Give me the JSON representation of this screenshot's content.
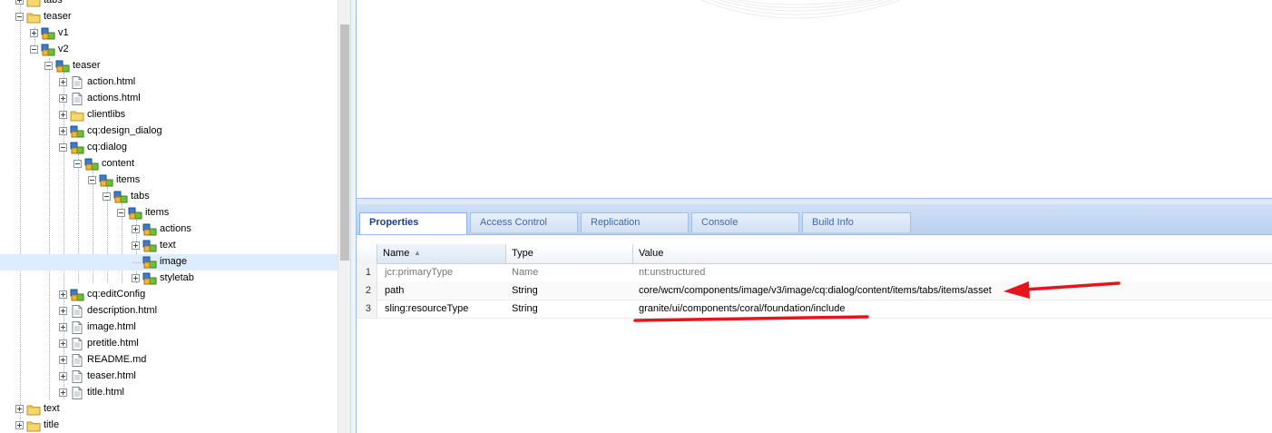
{
  "tree": {
    "nodes": [
      {
        "label": "tabs",
        "icon": "folder-icon",
        "expander": "plus"
      },
      {
        "label": "teaser",
        "icon": "folder-icon",
        "expander": "minus"
      },
      {
        "label": "v1",
        "icon": "component-node-icon",
        "expander": "plus"
      },
      {
        "label": "v2",
        "icon": "component-node-icon",
        "expander": "minus"
      },
      {
        "label": "teaser",
        "icon": "component-node-icon",
        "expander": "minus"
      },
      {
        "label": "action.html",
        "icon": "file-icon",
        "expander": "plus"
      },
      {
        "label": "actions.html",
        "icon": "file-icon",
        "expander": "plus"
      },
      {
        "label": "clientlibs",
        "icon": "folder-icon",
        "expander": "plus"
      },
      {
        "label": "cq:design_dialog",
        "icon": "component-node-icon",
        "expander": "plus"
      },
      {
        "label": "cq:dialog",
        "icon": "component-node-icon",
        "expander": "minus"
      },
      {
        "label": "content",
        "icon": "component-node-icon",
        "expander": "minus"
      },
      {
        "label": "items",
        "icon": "component-node-icon",
        "expander": "minus"
      },
      {
        "label": "tabs",
        "icon": "component-node-icon",
        "expander": "minus"
      },
      {
        "label": "items",
        "icon": "component-node-icon",
        "expander": "minus"
      },
      {
        "label": "actions",
        "icon": "component-node-icon",
        "expander": "plus"
      },
      {
        "label": "text",
        "icon": "component-node-icon",
        "expander": "plus"
      },
      {
        "label": "image",
        "icon": "component-node-icon",
        "expander": "none",
        "selected": true
      },
      {
        "label": "styletab",
        "icon": "component-node-icon",
        "expander": "plus"
      },
      {
        "label": "cq:editConfig",
        "icon": "component-node-icon",
        "expander": "plus"
      },
      {
        "label": "description.html",
        "icon": "file-icon",
        "expander": "plus"
      },
      {
        "label": "image.html",
        "icon": "file-icon",
        "expander": "plus"
      },
      {
        "label": "pretitle.html",
        "icon": "file-icon",
        "expander": "plus"
      },
      {
        "label": "README.md",
        "icon": "file-icon",
        "expander": "plus"
      },
      {
        "label": "teaser.html",
        "icon": "file-icon",
        "expander": "plus"
      },
      {
        "label": "title.html",
        "icon": "file-icon",
        "expander": "plus"
      },
      {
        "label": "text",
        "icon": "folder-icon",
        "expander": "plus"
      },
      {
        "label": "title",
        "icon": "folder-icon",
        "expander": "plus"
      }
    ]
  },
  "tabs": [
    {
      "label": "Properties",
      "active": true
    },
    {
      "label": "Access Control"
    },
    {
      "label": "Replication"
    },
    {
      "label": "Console"
    },
    {
      "label": "Build Info"
    }
  ],
  "grid": {
    "columns": {
      "name": "Name",
      "type": "Type",
      "value": "Value"
    },
    "rows": [
      {
        "num": "1",
        "name": "jcr:primaryType",
        "type": "Name",
        "value": "nt:unstructured",
        "muted": true
      },
      {
        "num": "2",
        "name": "path",
        "type": "String",
        "value": "core/wcm/components/image/v3/image/cq:dialog/content/items/tabs/items/asset"
      },
      {
        "num": "3",
        "name": "sling:resourceType",
        "type": "String",
        "value": "granite/ui/components/coral/foundation/include"
      }
    ]
  },
  "colors": {
    "annotation": "#e8141b",
    "selection": "#ddecfe",
    "tab_active_text": "#15428b"
  }
}
